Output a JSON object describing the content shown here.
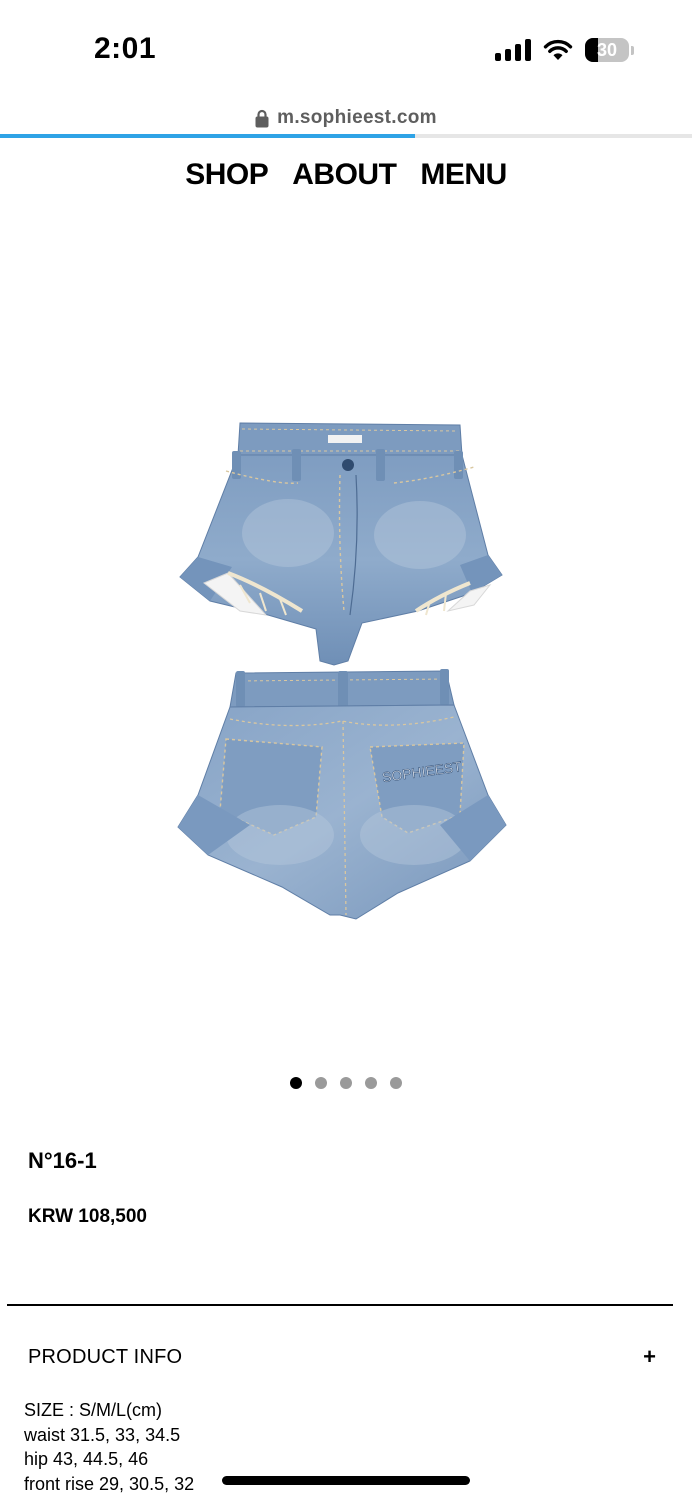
{
  "status_bar": {
    "time": "2:01",
    "battery_level": "30",
    "battery_fraction": 0.3
  },
  "browser": {
    "url": "m.sophieest.com",
    "load_progress": 0.6,
    "progress_color": "#2ea3e6"
  },
  "nav": {
    "items": [
      "SHOP",
      "ABOUT",
      "MENU"
    ]
  },
  "product": {
    "image_alt": "denim shorts front and back",
    "back_pocket_text": "SOPHIEEST",
    "carousel": {
      "total": 5,
      "active_index": 0
    },
    "name": "N°16-1",
    "price": "KRW 108,500"
  },
  "product_info": {
    "title": "PRODUCT INFO",
    "toggle": "+",
    "lines": [
      "SIZE : S/M/L(cm)",
      "waist 31.5, 33, 34.5",
      "hip 43, 44.5, 46",
      "front rise 29, 30.5, 32"
    ]
  },
  "icons": [
    "lock-icon",
    "signal-icon",
    "wifi-icon",
    "battery-icon"
  ]
}
